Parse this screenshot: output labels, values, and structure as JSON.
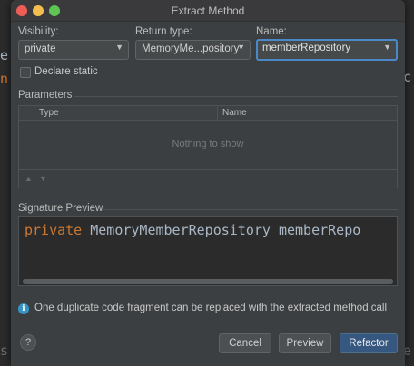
{
  "background": {
    "left_glyphs": [
      "e",
      "n"
    ],
    "right_glyph": "c",
    "bottom_left_glyph": "s",
    "bottom_right_glyph": "e"
  },
  "dialog": {
    "title": "Extract Method",
    "visibility": {
      "label": "Visibility:",
      "value": "private"
    },
    "return_type": {
      "label": "Return type:",
      "value": "MemoryMe...pository"
    },
    "name": {
      "label": "Name:",
      "value": "memberRepository"
    },
    "declare_static": {
      "label": "Declare static",
      "checked": false
    },
    "parameters": {
      "label": "Parameters",
      "columns": [
        "Type",
        "Name"
      ],
      "empty_text": "Nothing to show"
    },
    "signature_preview": {
      "label": "Signature Preview",
      "keyword": "private",
      "rest": " MemoryMemberRepository memberRepo"
    },
    "info": {
      "icon": "info-icon",
      "text": "One duplicate code fragment can be replaced with the extracted method call"
    },
    "buttons": {
      "help": "?",
      "cancel": "Cancel",
      "preview": "Preview",
      "refactor": "Refactor"
    }
  },
  "colors": {
    "accent_focus": "#4a88c7",
    "primary_button": "#365880",
    "keyword": "#cc7832",
    "info": "#3592c4"
  }
}
